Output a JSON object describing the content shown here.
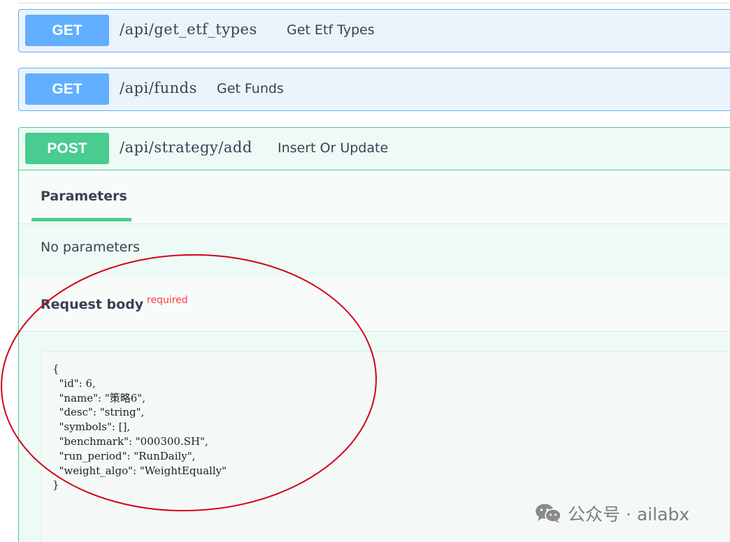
{
  "operations": [
    {
      "method": "GET",
      "path": "/api/get_etf_types",
      "summary": "Get Etf Types"
    },
    {
      "method": "GET",
      "path": "/api/funds",
      "summary": "Get Funds"
    },
    {
      "method": "POST",
      "path": "/api/strategy/add",
      "summary": "Insert Or Update"
    }
  ],
  "post_section": {
    "tab_label": "Parameters",
    "no_params_text": "No parameters",
    "request_body_title": "Request body",
    "required_label": "required",
    "code_lines": [
      "{",
      "  \"id\": 6,",
      "  \"name\": \"策略6\",",
      "  \"desc\": \"string\",",
      "  \"symbols\": [],",
      "  \"benchmark\": \"000300.SH\",",
      "  \"run_period\": \"RunDaily\",",
      "  \"weight_algo\": \"WeightEqually\"",
      "}"
    ]
  },
  "watermark": {
    "text": "公众号 · ailabx",
    "icon": "wechat-icon"
  },
  "colors": {
    "get_accent": "#61affe",
    "post_accent": "#49cc90",
    "annotation": "#d0021b",
    "required": "#f93e3e"
  }
}
